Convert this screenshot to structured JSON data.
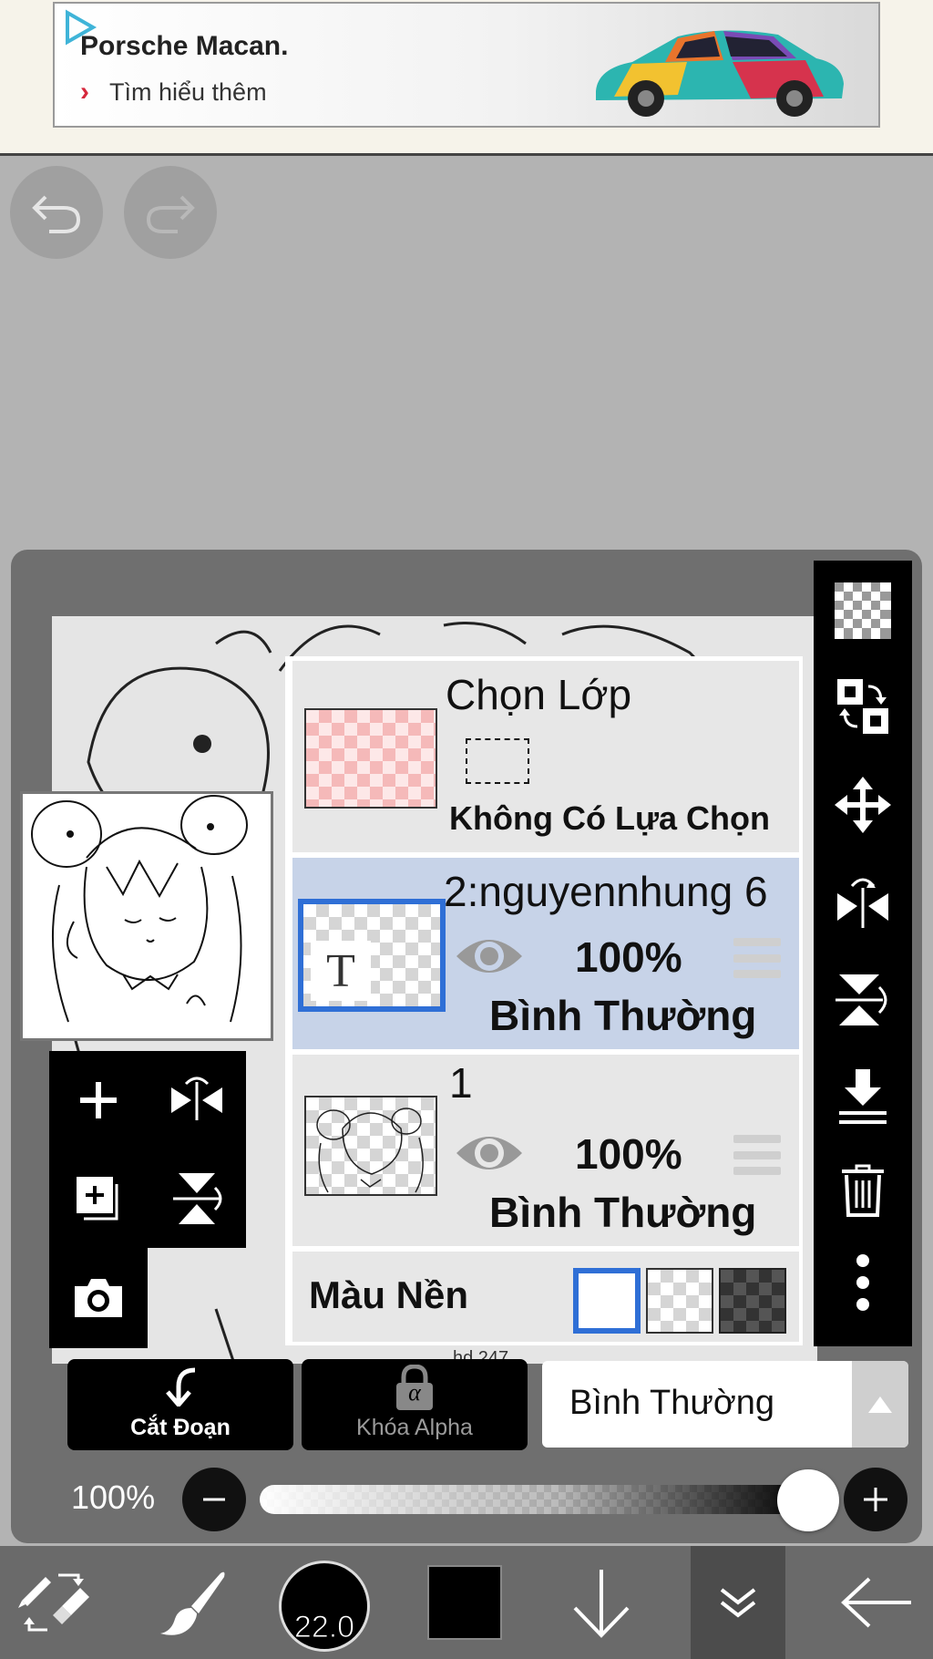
{
  "ad": {
    "title": "Porsche Macan.",
    "link_text": "Tìm hiểu thêm"
  },
  "top_actions": {
    "undo_icon": "undo-icon",
    "redo_icon": "redo-icon"
  },
  "layers": {
    "selection_layer": {
      "title": "Chọn Lớp",
      "status": "Không Có Lựa Chọn"
    },
    "items": [
      {
        "name": "2:nguyennhung 6",
        "opacity": "100%",
        "blend": "Bình Thường",
        "selected": true,
        "thumb_glyph": "T"
      },
      {
        "name": "1",
        "opacity": "100%",
        "blend": "Bình Thường",
        "selected": false
      }
    ],
    "background": {
      "label": "Màu Nền",
      "options": [
        "white",
        "checker",
        "dark-checker"
      ],
      "selected": "white"
    }
  },
  "actions": {
    "clipping_label": "Cắt Đoạn",
    "alpha_lock_label": "Khóa Alpha",
    "alpha_glyph": "α",
    "blend_mode": "Bình Thường"
  },
  "opacity": {
    "label": "100%",
    "value": 1.0
  },
  "bottom_toolbar": {
    "brush_size": "22.0"
  },
  "canvas": {
    "watermark": "hd 247"
  },
  "colors": {
    "accent": "#2f6fd6",
    "selected_row": "#c7d3e8",
    "panel": "#6f6f6f",
    "toolbar": "#000000"
  }
}
